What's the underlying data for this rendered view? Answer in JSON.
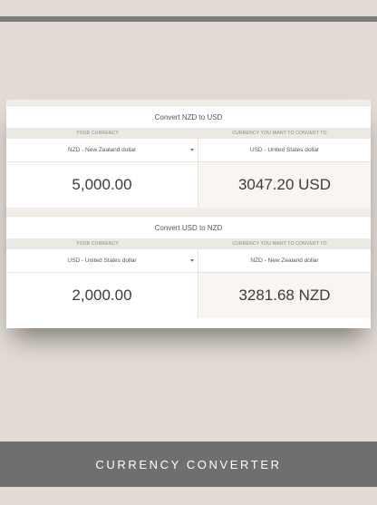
{
  "converters": [
    {
      "title": "Convert NZD to USD",
      "your_currency_label": "YOUR CURRENCY",
      "target_currency_label": "CURRENCY YOU WANT TO CONVERT TO",
      "from_currency": "NZD - New Zealand dollar",
      "to_currency": "USD - United States dollar",
      "amount": "5,000.00",
      "result": "3047.20 USD"
    },
    {
      "title": "Convert USD to NZD",
      "your_currency_label": "YOUR CURRENCY",
      "target_currency_label": "CURRENCY YOU WANT TO CONVERT TO",
      "from_currency": "USD - United States dollar",
      "to_currency": "NZD - New Zealand dollar",
      "amount": "2,000.00",
      "result": "3281.68 NZD"
    }
  ],
  "footer": {
    "label": "CURRENCY CONVERTER"
  },
  "colors": {
    "background": "#e2dad3",
    "footer": "#6f6f6d",
    "result_bg": "#f9f6f2"
  }
}
